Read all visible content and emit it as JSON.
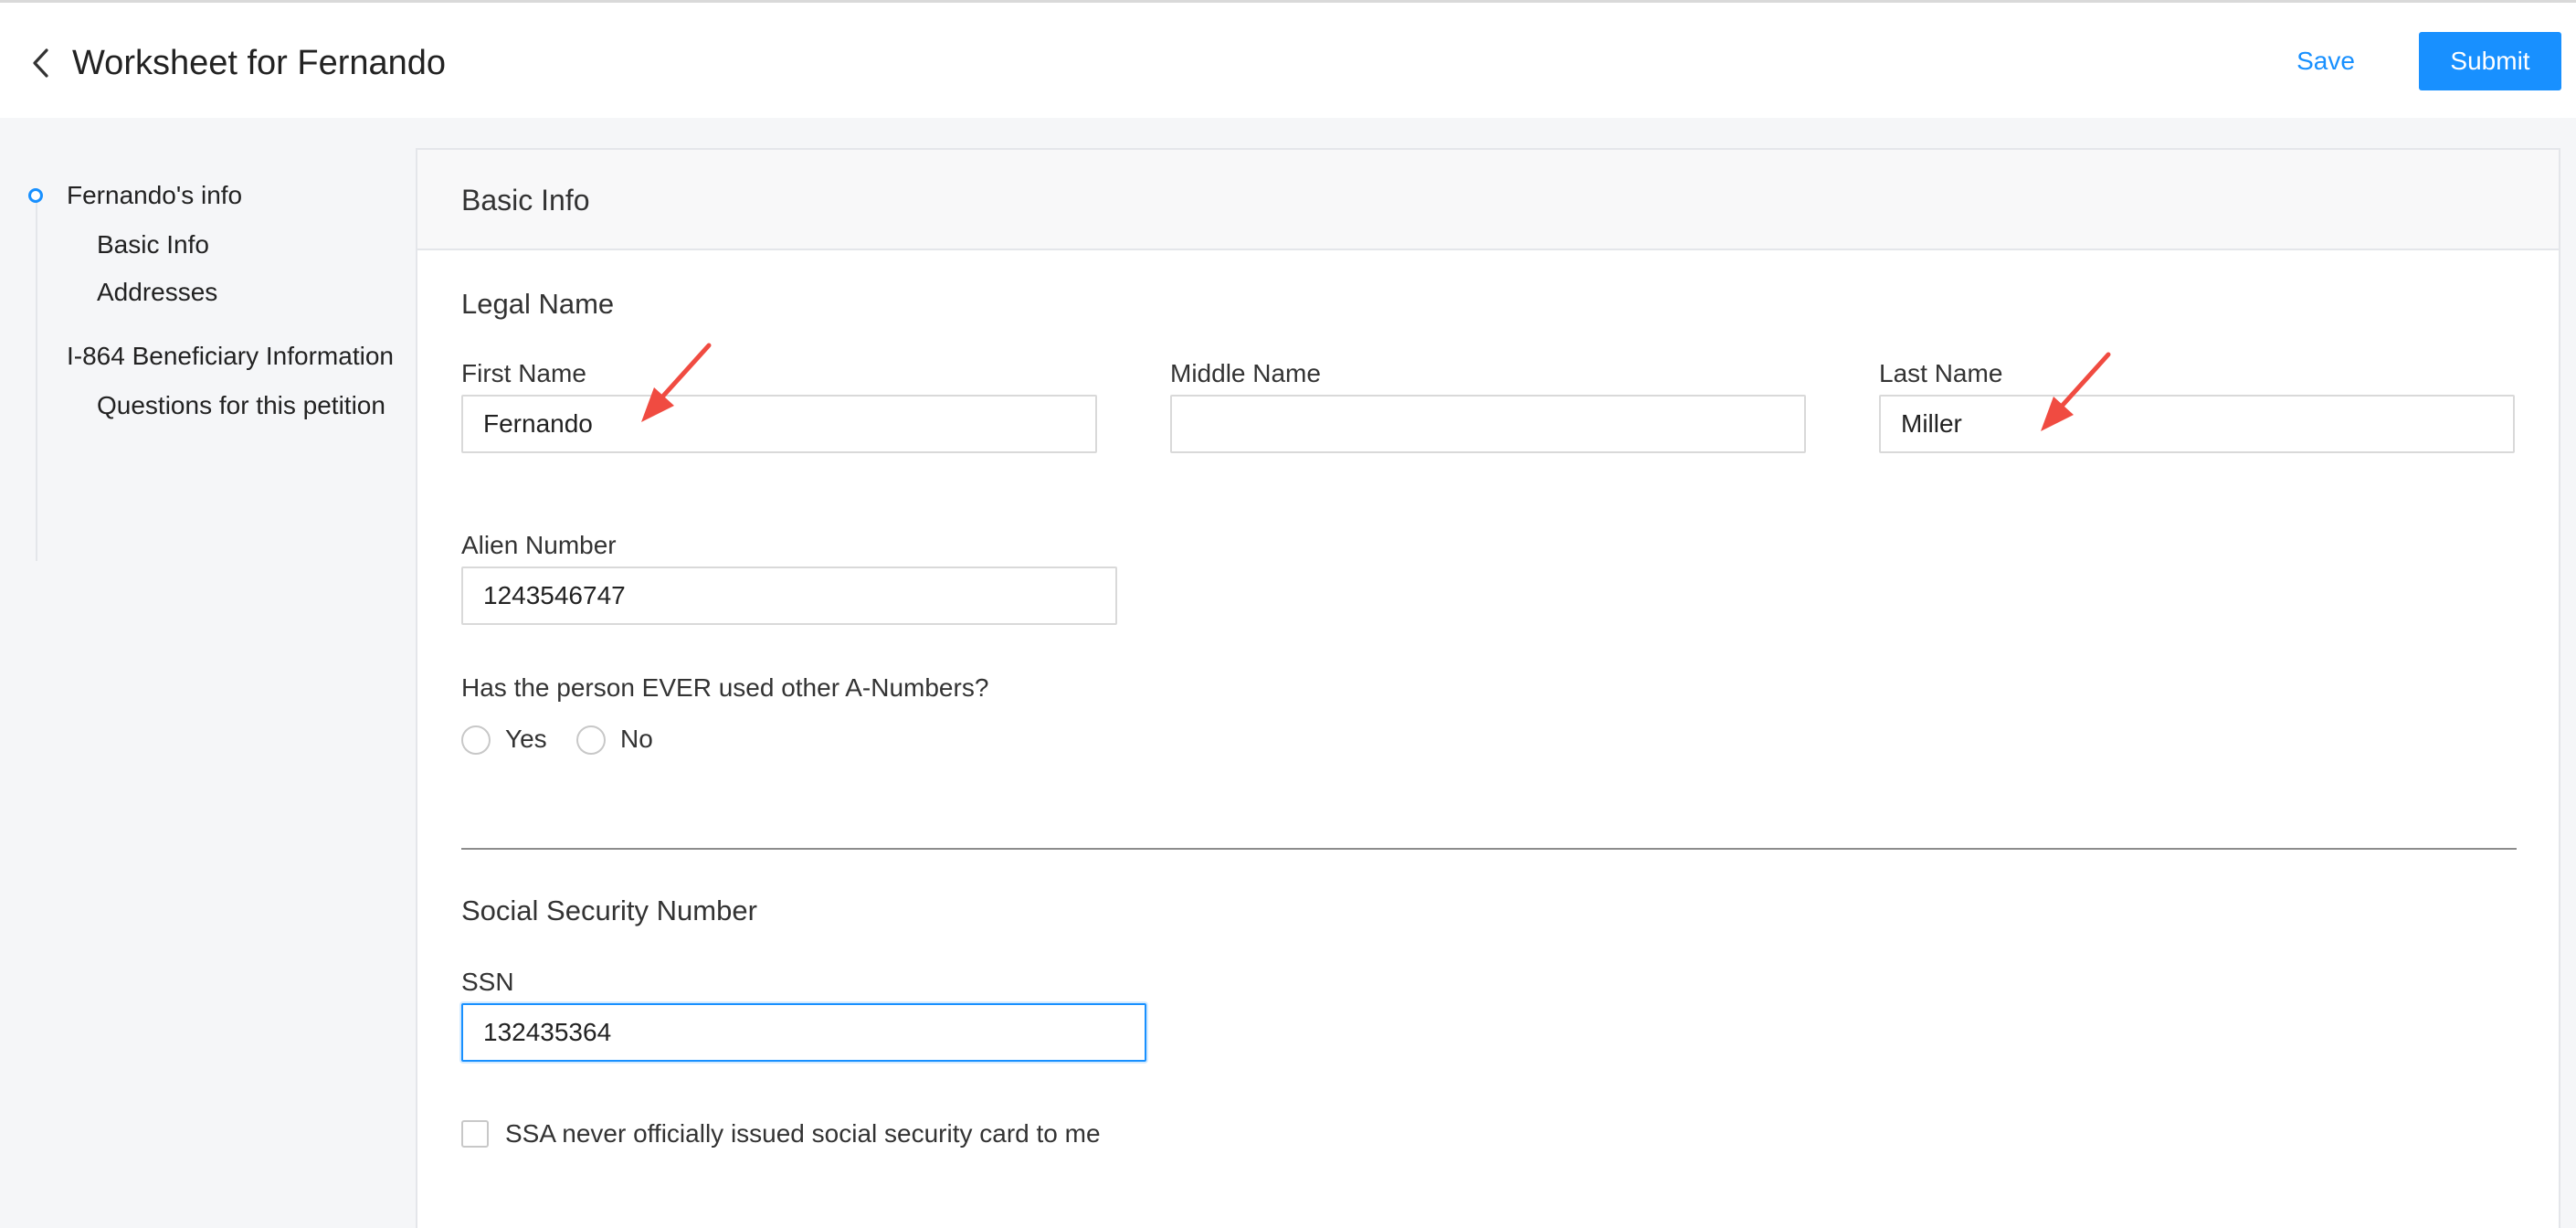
{
  "header": {
    "title": "Worksheet for Fernando",
    "save_label": "Save",
    "submit_label": "Submit",
    "back_icon": "chevron-left-icon"
  },
  "sidebar": {
    "items": [
      {
        "label": "Fernando's info",
        "active": true
      },
      {
        "label": "Basic Info"
      },
      {
        "label": "Addresses"
      },
      {
        "label": "I-864 Beneficiary Information"
      },
      {
        "label": "Questions for this petition"
      }
    ]
  },
  "card": {
    "title": "Basic Info",
    "legal_name": {
      "title": "Legal Name",
      "first_name": {
        "label": "First Name",
        "value": "Fernando"
      },
      "middle_name": {
        "label": "Middle Name",
        "value": ""
      },
      "last_name": {
        "label": "Last Name",
        "value": "Miller"
      }
    },
    "alien_number": {
      "label": "Alien Number",
      "value": "1243546747"
    },
    "other_a_numbers": {
      "question": "Has the person EVER used other A-Numbers?",
      "options": [
        "Yes",
        "No"
      ]
    },
    "ssn_section": {
      "title": "Social Security Number",
      "ssn": {
        "label": "SSN",
        "value": "132435364"
      },
      "never_issued": {
        "label": "SSA never officially issued social security card to me",
        "checked": false
      }
    }
  },
  "colors": {
    "accent": "#1890ff",
    "annotation_arrow": "#f04b41"
  }
}
